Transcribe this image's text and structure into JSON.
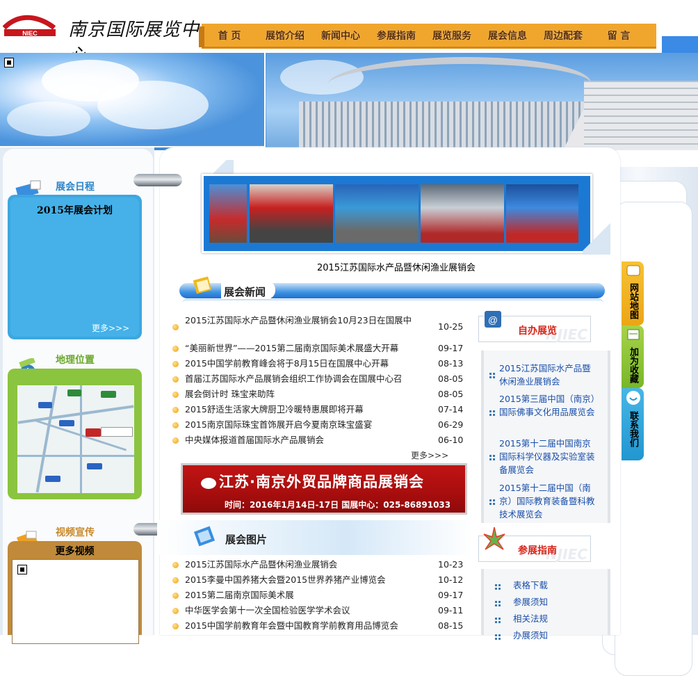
{
  "header": {
    "logo_text": "南京国际展览中心",
    "logo_abbr": "NIEC",
    "nav": [
      "首 页",
      "展馆介绍",
      "新闻中心",
      "参展指南",
      "展览服务",
      "展会信息",
      "周边配套",
      "留 言"
    ]
  },
  "left": {
    "schedule_title": "展会日程",
    "schedule_heading": "2015年展会计划",
    "schedule_more": "更多>>>",
    "geo_title": "地理位置",
    "video_title": "视频宣传",
    "video_more": "更多视频"
  },
  "center": {
    "photo_caption": "2015江苏国际水产品暨休闲渔业展销会",
    "news_section": "展会新闻",
    "news": [
      {
        "title": "2015江苏国际水产品暨休闲渔业展销会10月23日在国展中",
        "date": "10-25"
      },
      {
        "title": "“美丽新世界”——2015第二届南京国际美术展盛大开幕",
        "date": "09-17"
      },
      {
        "title": "2015中国学前教育峰会将于8月15日在国展中心开幕",
        "date": "08-13"
      },
      {
        "title": "首届江苏国际水产品展销会组织工作协调会在国展中心召",
        "date": "08-05"
      },
      {
        "title": "展会倒计时 珠宝来助阵",
        "date": "08-05"
      },
      {
        "title": "2015舒适生活家大牌厨卫冷暖特惠展即将开幕",
        "date": "07-14"
      },
      {
        "title": "2015南京国际珠宝首饰展开启今夏南京珠宝盛宴",
        "date": "06-29"
      },
      {
        "title": "中央媒体报道首届国际水产品展销会",
        "date": "06-10"
      }
    ],
    "news_more": "更多>>>",
    "ad_main": "江苏·南京外贸品牌商品展销会",
    "ad_sub": "时间：2016年1月14日-17日    国展中心：025-86891033",
    "photos_section": "展会图片",
    "photos": [
      {
        "title": "2015江苏国际水产品暨休闲渔业展销会",
        "date": "10-23"
      },
      {
        "title": "2015李曼中国养猪大会暨2015世界养猪产业博览会",
        "date": "10-12"
      },
      {
        "title": "2015第二届南京国际美术展",
        "date": "09-17"
      },
      {
        "title": "中华医学会第十一次全国检验医学学术会议",
        "date": "09-11"
      },
      {
        "title": "2015中国学前教育年会暨中国教育学前教育用品博览会",
        "date": "08-15"
      }
    ]
  },
  "right": {
    "self_title": "自办展览",
    "watermark": "NJIEC",
    "self_items": [
      "2015江苏国际水产品暨休闲渔业展销会",
      "2015第三届中国（南京）国际佛事文化用品展览会",
      "2015第十二届中国南京国际科学仪器及实验室装备展览会",
      "2015第十二届中国（南京）国际教育装备暨科教技术展览会"
    ],
    "guide_title": "参展指南",
    "guide_items": [
      "表格下载",
      "参展须知",
      "相关法规",
      "办展须知"
    ]
  },
  "side_tabs": [
    "网站地图",
    "加为收藏",
    "联系我们"
  ],
  "colors": {
    "nav_bg": "#f0a62c",
    "accent_blue": "#1b79d4",
    "link_blue": "#1b4fa8",
    "ad_red": "#b01010"
  }
}
